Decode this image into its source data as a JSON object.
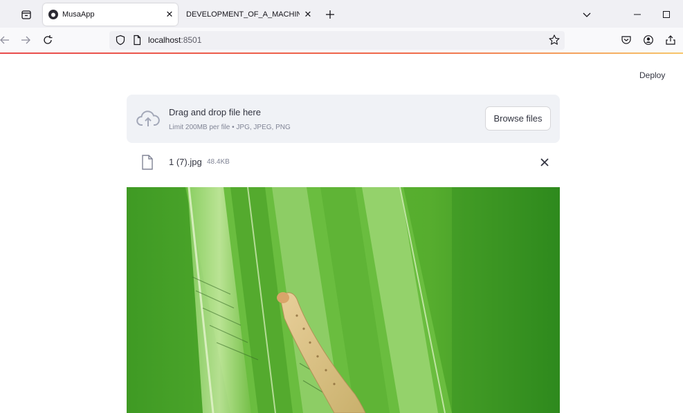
{
  "browser": {
    "tabs": [
      {
        "label": "MusaApp",
        "active": true
      },
      {
        "label": "DEVELOPMENT_OF_A_MACHINE_LE",
        "active": false
      }
    ],
    "url": {
      "host": "localhost",
      "port": ":8501"
    }
  },
  "app": {
    "deploy_label": "Deploy",
    "uploader": {
      "main_text": "Drag and drop file here",
      "limit_text": "Limit 200MB per file • JPG, JPEG, PNG",
      "browse_label": "Browse files"
    },
    "file": {
      "name": "1 (7).jpg",
      "size": "48.4KB"
    }
  },
  "colors": {
    "uploader_bg": "#f0f2f6",
    "text": "#31333f",
    "muted": "#808495",
    "leaf_green": "#4aa22a"
  }
}
